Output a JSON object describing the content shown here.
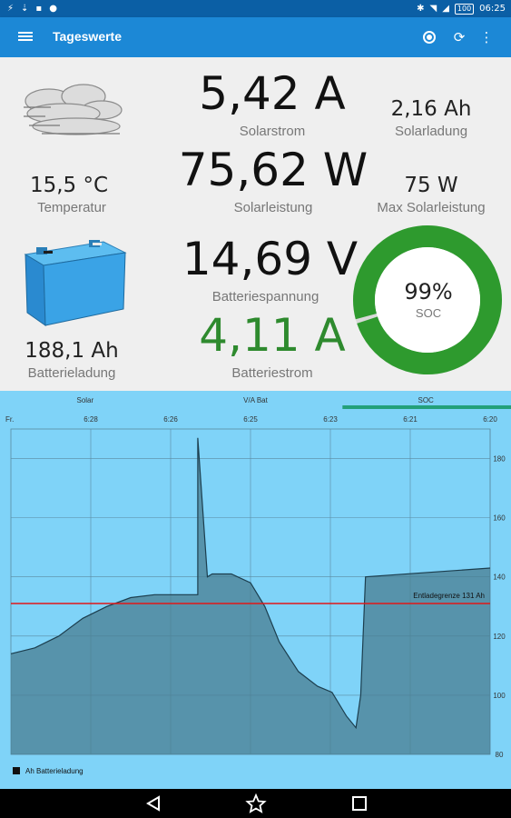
{
  "statusbar": {
    "time": "06:25",
    "battery": "100"
  },
  "appbar": {
    "title": "Tageswerte"
  },
  "stats": {
    "solar_current": {
      "value": "5,42 A",
      "label": "Solarstrom"
    },
    "solar_charge": {
      "value": "2,16 Ah",
      "label": "Solarladung"
    },
    "temperature": {
      "value": "15,5 °C",
      "label": "Temperatur"
    },
    "solar_power": {
      "value": "75,62 W",
      "label": "Solarleistung"
    },
    "max_solar_power": {
      "value": "75 W",
      "label": "Max Solarleistung"
    },
    "battery_voltage": {
      "value": "14,69 V",
      "label": "Batteriespannung"
    },
    "battery_charge": {
      "value": "188,1 Ah",
      "label": "Batterieladung"
    },
    "battery_current": {
      "value": "4,11 A",
      "label": "Batteriestrom"
    },
    "soc": {
      "value": "99%",
      "label": "SOC",
      "fraction": 0.99
    }
  },
  "colors": {
    "appbar": "#1c88d6",
    "statusbar": "#0b5fa5",
    "green": "#2e9a2e",
    "chart_bg": "#7fd3f8",
    "limit_line": "#e01818"
  },
  "chart_tabs": [
    {
      "label": "Solar",
      "active": false
    },
    {
      "label": "V/A Bat",
      "active": false
    },
    {
      "label": "SOC",
      "active": true
    }
  ],
  "chart_data": {
    "type": "area",
    "title": "",
    "x_label_start": "Fr.",
    "x_ticks": [
      "6:28",
      "6:26",
      "6:25",
      "6:23",
      "6:21",
      "6:20"
    ],
    "y_ticks": [
      80,
      100,
      120,
      140,
      160,
      180
    ],
    "ylim": [
      80,
      190
    ],
    "legend": "Ah Batterieladung",
    "legend_position": "bottom-left",
    "grid": true,
    "threshold": {
      "label": "Entladegrenze 131 Ah",
      "value": 131
    },
    "series": [
      {
        "name": "Ah Batterieladung",
        "x": [
          0,
          0.05,
          0.1,
          0.15,
          0.2,
          0.25,
          0.3,
          0.35,
          0.38,
          0.39,
          0.39,
          0.41,
          0.41,
          0.42,
          0.46,
          0.5,
          0.53,
          0.56,
          0.6,
          0.64,
          0.67,
          0.7,
          0.72,
          0.73,
          0.74,
          1.0
        ],
        "y": [
          114,
          116,
          120,
          126,
          130,
          133,
          134,
          134,
          134,
          134,
          187,
          140,
          140,
          141,
          141,
          138,
          130,
          118,
          108,
          103,
          101,
          93,
          89,
          100,
          140,
          143
        ]
      }
    ]
  },
  "nav": {
    "back": "back-icon",
    "home": "star-icon",
    "recents": "square-icon"
  }
}
